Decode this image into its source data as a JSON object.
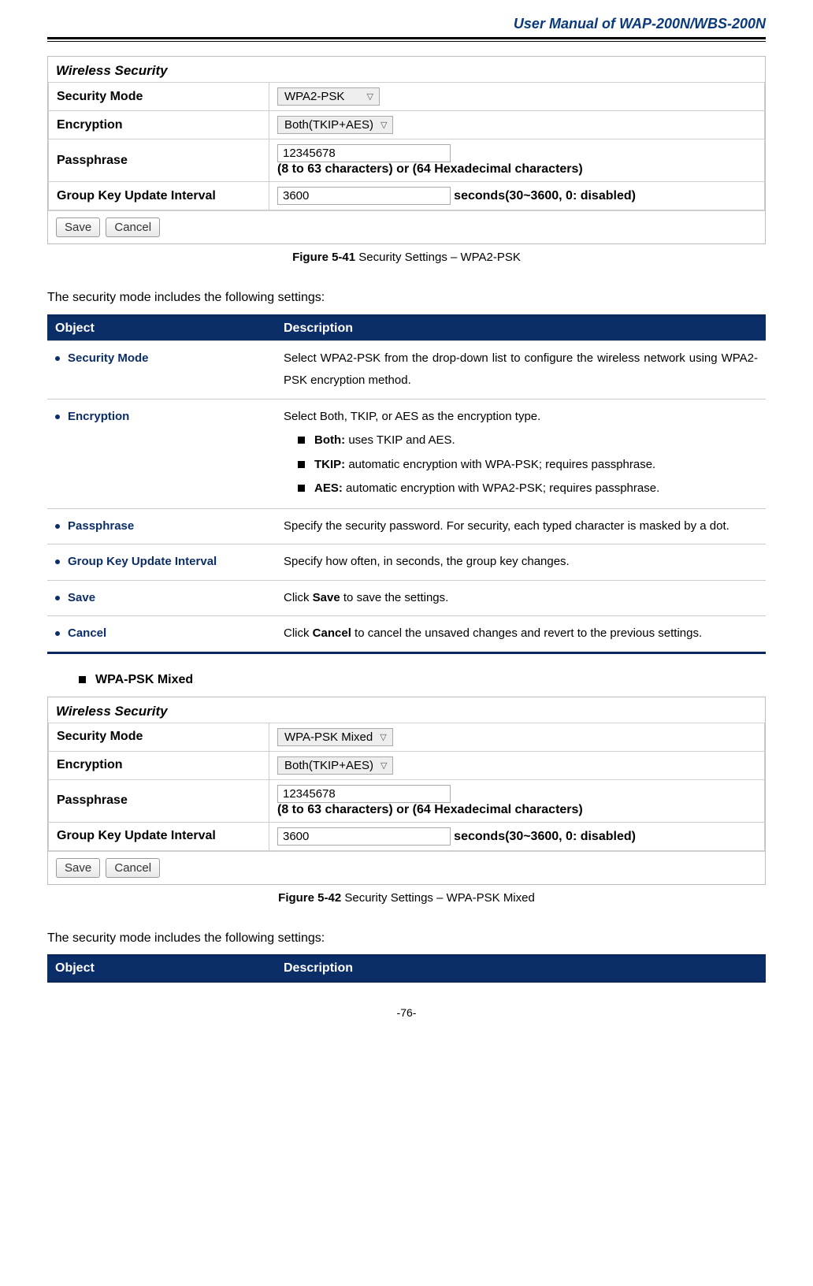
{
  "header": {
    "title": "User Manual of WAP-200N/WBS-200N"
  },
  "figure1": {
    "panel_title": "Wireless Security",
    "rows": {
      "security_mode": {
        "label": "Security Mode",
        "value": "WPA2-PSK"
      },
      "encryption": {
        "label": "Encryption",
        "value": "Both(TKIP+AES)"
      },
      "passphrase": {
        "label": "Passphrase",
        "value": "12345678",
        "hint": "(8 to 63 characters) or (64 Hexadecimal characters)"
      },
      "interval": {
        "label": "Group Key Update Interval",
        "value": "3600",
        "hint": "seconds(30~3600, 0: disabled)"
      }
    },
    "buttons": {
      "save": "Save",
      "cancel": "Cancel"
    },
    "caption_bold": "Figure 5-41",
    "caption_rest": " Security Settings – WPA2-PSK"
  },
  "para1": "The security mode includes the following settings:",
  "table1": {
    "head_obj": "Object",
    "head_desc": "Description",
    "rows": [
      {
        "obj": "Security Mode",
        "desc_plain": "Select WPA2-PSK from the drop-down list to configure the wireless network using WPA2-PSK encryption method."
      },
      {
        "obj": "Encryption",
        "desc_lead": "Select Both, TKIP, or AES as the encryption type.",
        "items": [
          {
            "b": "Both:",
            "t": " uses TKIP and AES."
          },
          {
            "b": "TKIP:",
            "t": " automatic encryption with WPA-PSK; requires passphrase."
          },
          {
            "b": "AES:",
            "t": " automatic encryption with WPA2-PSK; requires passphrase."
          }
        ]
      },
      {
        "obj": "Passphrase",
        "desc_plain": "Specify the security password. For security, each typed character is masked by a dot."
      },
      {
        "obj": "Group Key Update Interval",
        "desc_plain": "Specify how often, in seconds, the group key changes."
      },
      {
        "obj": "Save",
        "desc_pre": "Click ",
        "desc_b": "Save",
        "desc_post": " to save the settings."
      },
      {
        "obj": "Cancel",
        "desc_pre": "Click ",
        "desc_b": "Cancel",
        "desc_post": " to cancel the unsaved changes and revert to the previous settings."
      }
    ]
  },
  "section2_title": "WPA-PSK Mixed",
  "figure2": {
    "panel_title": "Wireless Security",
    "rows": {
      "security_mode": {
        "label": "Security Mode",
        "value": "WPA-PSK Mixed"
      },
      "encryption": {
        "label": "Encryption",
        "value": "Both(TKIP+AES)"
      },
      "passphrase": {
        "label": "Passphrase",
        "value": "12345678",
        "hint": "(8 to 63 characters) or (64 Hexadecimal characters)"
      },
      "interval": {
        "label": "Group Key Update Interval",
        "value": "3600",
        "hint": "seconds(30~3600, 0: disabled)"
      }
    },
    "buttons": {
      "save": "Save",
      "cancel": "Cancel"
    },
    "caption_bold": "Figure 5-42",
    "caption_rest": " Security Settings – WPA-PSK Mixed"
  },
  "para2": "The security mode includes the following settings:",
  "table2": {
    "head_obj": "Object",
    "head_desc": "Description"
  },
  "footer": "-76-"
}
